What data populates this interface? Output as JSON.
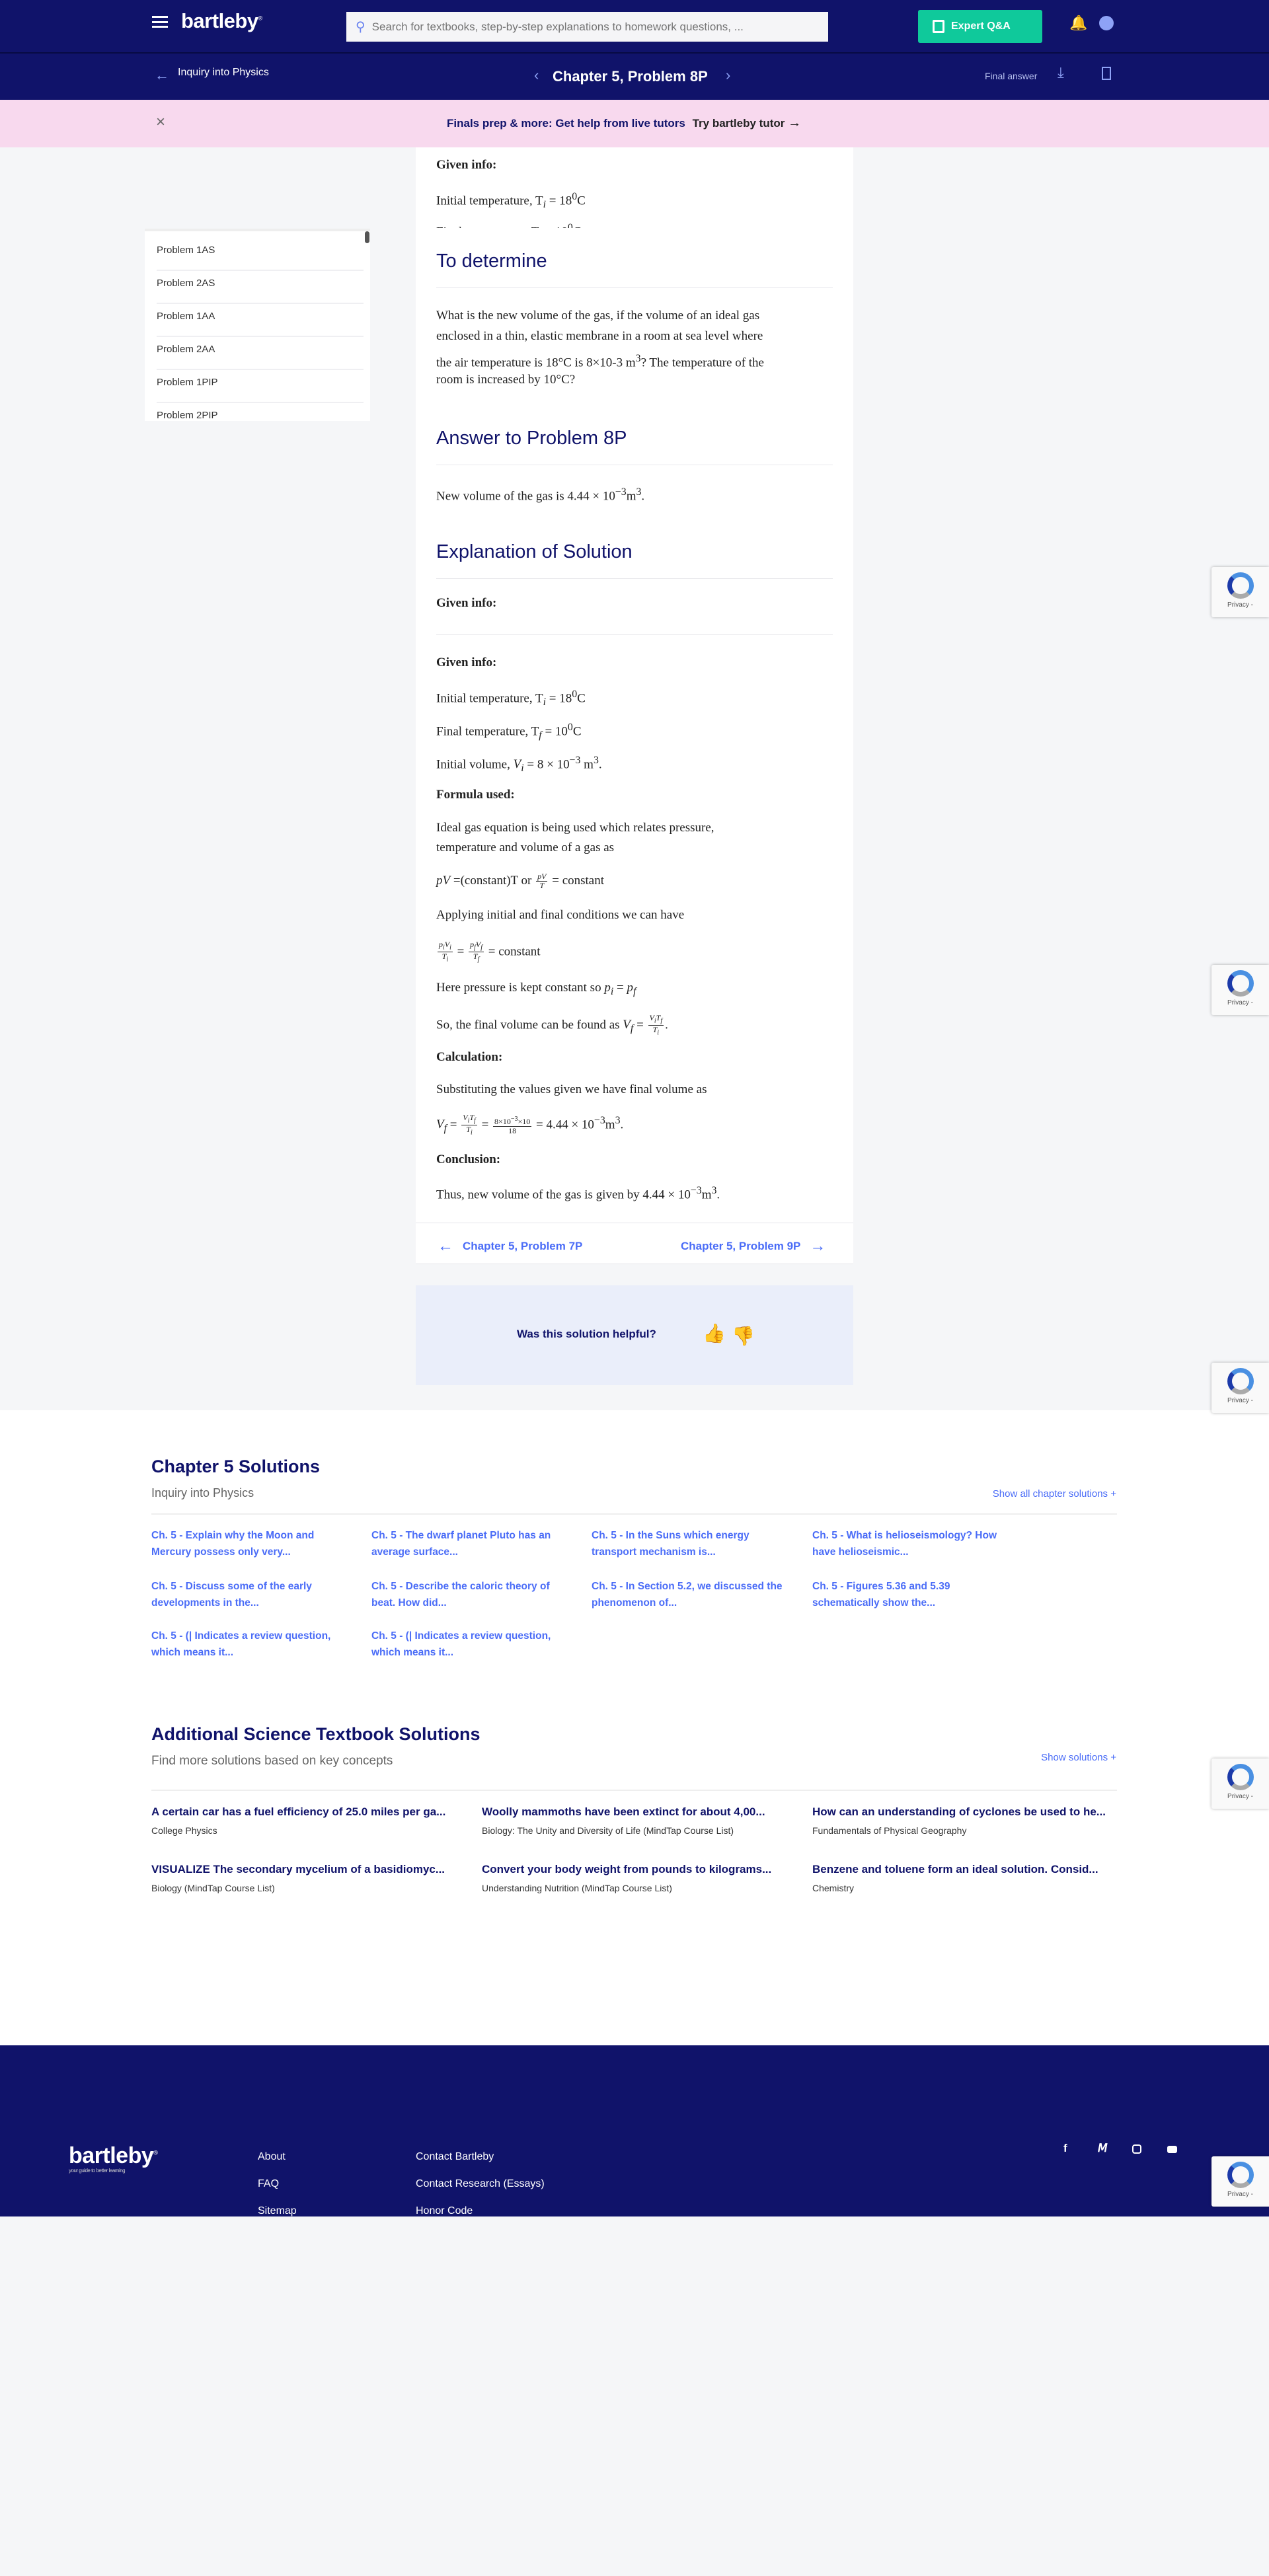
{
  "header": {
    "logo": "bartleby",
    "search_placeholder": "Search for textbooks, step-by-step explanations to homework questions, ...",
    "expert_label": "Expert Q&A"
  },
  "subbar": {
    "back_label": "Inquiry into Physics",
    "title": "Chapter 5, Problem 8P",
    "final_answer": "Final answer"
  },
  "banner": {
    "text": "Finals prep & more: Get help from live tutors",
    "cta": "Try bartleby tutor"
  },
  "sidebar": {
    "items": [
      "Problem 1AS",
      "Problem 2AS",
      "Problem 1AA",
      "Problem 2AA",
      "Problem 1PIP",
      "Problem 2PIP"
    ]
  },
  "solution": {
    "preview_given": "Given info:",
    "preview_line1": "Initial temperature, ",
    "to_determine": "To determine",
    "question": [
      "What is the new volume of the gas, if the volume of an ideal gas",
      "enclosed in a thin, elastic membrane in a room at sea level where",
      "the air temperature is 18°C is 8×10-3 m",
      "? The temperature of the",
      "room is increased by 10°C?"
    ],
    "answer_heading": "Answer to Problem 8P",
    "answer_text": "New volume of the gas is ",
    "answer_value": "4.44 × 10",
    "explanation_heading": "Explanation of Solution",
    "given_info": "Given info:",
    "initial_temp_label": "Initial temperature, ",
    "final_temp_label": "Final temperature, ",
    "initial_vol_label": "Initial volume, ",
    "initial_vol_value": "= 8 × 10",
    "formula_used": "Formula used:",
    "ideal_gas": [
      "Ideal gas equation is being used which relates pressure,",
      "temperature and volume of a gas as"
    ],
    "pv_eq": "=(constant)T or ",
    "constant": "= constant",
    "applying": "Applying initial and final conditions we can have",
    "pressure_const": "Here pressure is kept constant so ",
    "final_vol_found": "So, the final volume can be found as ",
    "calculation": "Calculation:",
    "substituting": "Substituting the values given we have final volume as",
    "calc_num": "8×10",
    "calc_den": "18",
    "calc_result": "= 4.44 × 10",
    "conclusion": "Conclusion:",
    "conclusion_text": "Thus, new volume of the gas is given by 4.44 × 10"
  },
  "nav": {
    "prev": "Chapter 5, Problem 7P",
    "next": "Chapter 5, Problem 9P"
  },
  "feedback": {
    "question": "Was this solution helpful?"
  },
  "chapter_solutions": {
    "title": "Chapter 5 Solutions",
    "subtitle": "Inquiry into Physics",
    "show_all": "Show all chapter solutions +",
    "links": [
      [
        "Ch. 5 - Explain why the Moon and",
        "Mercury possess only very..."
      ],
      [
        "Ch. 5 - The dwarf planet Pluto has an",
        "average surface..."
      ],
      [
        "Ch. 5 - In the Suns which energy",
        "transport mechanism is..."
      ],
      [
        "Ch. 5 - What is helioseismology? How",
        "have helioseismic..."
      ],
      [
        "Ch. 5 - Discuss some of the early",
        "developments in the..."
      ],
      [
        "Ch. 5 - Describe the caloric theory of",
        "beat. How did..."
      ],
      [
        "Ch. 5 - In Section 5.2, we discussed the",
        "phenomenon of..."
      ],
      [
        "Ch. 5 - Figures 5.36 and 5.39",
        "schematically show the..."
      ],
      [
        "Ch. 5 - (| Indicates a review question,",
        "which means it..."
      ],
      [
        "Ch. 5 - (| Indicates a review question,",
        "which means it..."
      ]
    ]
  },
  "additional": {
    "title": "Additional Science Textbook Solutions",
    "subtitle": "Find more solutions based on key concepts",
    "show": "Show solutions +",
    "items": [
      {
        "title": "A certain car has a fuel efficiency of 25.0 miles per ga...",
        "book": "College Physics"
      },
      {
        "title": "Woolly mammoths have been extinct for about 4,00...",
        "book": "Biology: The Unity and Diversity of Life (MindTap Course List)"
      },
      {
        "title": "How can an understanding of cyclones be used to he...",
        "book": "Fundamentals of Physical Geography"
      },
      {
        "title": "VISUALIZE The secondary mycelium of a basidiomyc...",
        "book": "Biology (MindTap Course List)"
      },
      {
        "title": "Convert your body weight from pounds to kilograms...",
        "book": "Understanding Nutrition (MindTap Course List)"
      },
      {
        "title": "Benzene and toluene form an ideal solution. Consid...",
        "book": "Chemistry"
      }
    ]
  },
  "footer": {
    "logo": "bartleby",
    "tagline": "your guide to better learning",
    "col1": [
      "About",
      "FAQ",
      "Sitemap"
    ],
    "col2": [
      "Contact Bartleby",
      "Contact Research (Essays)",
      "Honor Code"
    ],
    "social": [
      "facebook-icon",
      "twitter-icon",
      "instagram-icon",
      "youtube-icon"
    ]
  },
  "recaptcha": {
    "label": "Privacy -"
  },
  "colors": {
    "navy": "#10136a",
    "accent_green": "#0fc99b",
    "link_blue": "#4a6cf7",
    "banner_pink": "#f8d9ee"
  }
}
